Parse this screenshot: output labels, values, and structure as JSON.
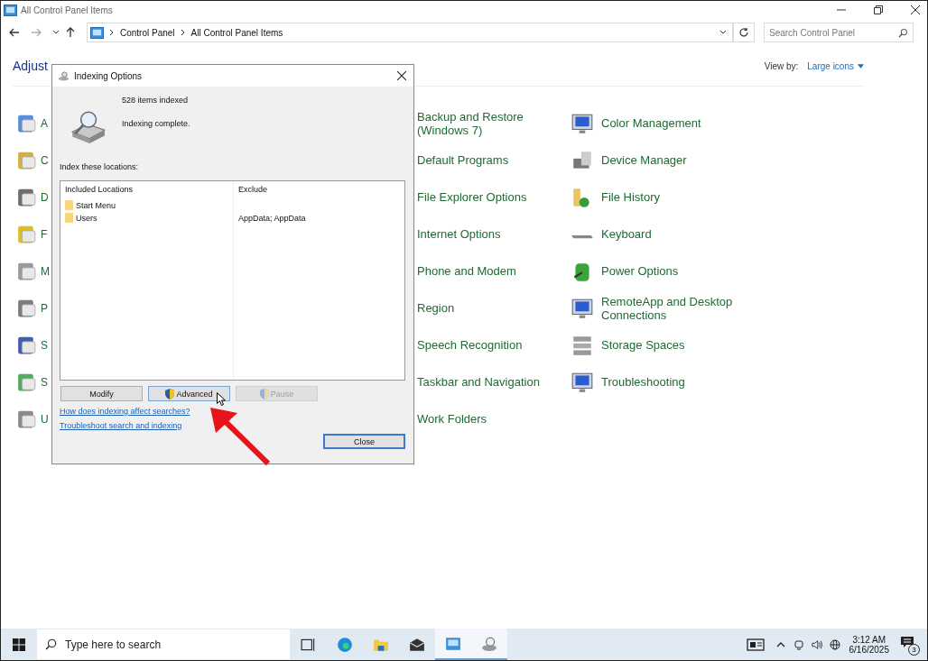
{
  "window": {
    "title": "All Control Panel Items"
  },
  "address_bar": {
    "path": [
      "Control Panel",
      "All Control Panel Items"
    ]
  },
  "search": {
    "placeholder": "Search Control Panel"
  },
  "heading": "Adjust",
  "view_by": {
    "label": "View by:",
    "value": "Large icons"
  },
  "items_column_1": [
    {
      "label": "A"
    },
    {
      "label": "C"
    },
    {
      "label": "D"
    },
    {
      "label": "F"
    },
    {
      "label": "M"
    },
    {
      "label": "P"
    },
    {
      "label": "S"
    },
    {
      "label": "S"
    },
    {
      "label": "U"
    }
  ],
  "items_column_2": [
    {
      "label": "Backup and Restore (Windows 7)"
    },
    {
      "label": "Default Programs"
    },
    {
      "label": "File Explorer Options"
    },
    {
      "label": "Internet Options"
    },
    {
      "label": "Phone and Modem"
    },
    {
      "label": "Region"
    },
    {
      "label": "Speech Recognition"
    },
    {
      "label": "Taskbar and Navigation"
    },
    {
      "label": "Work Folders"
    }
  ],
  "items_column_3": [
    {
      "label": "Color Management"
    },
    {
      "label": "Device Manager"
    },
    {
      "label": "File History"
    },
    {
      "label": "Keyboard"
    },
    {
      "label": "Power Options"
    },
    {
      "label": "RemoteApp and Desktop Connections"
    },
    {
      "label": "Storage Spaces"
    },
    {
      "label": "Troubleshooting"
    }
  ],
  "dialog": {
    "title": "Indexing Options",
    "count": "528 items indexed",
    "status": "Indexing complete.",
    "locations_label": "Index these locations:",
    "columns": [
      "Included Locations",
      "Exclude"
    ],
    "rows": [
      {
        "location": "Start Menu",
        "exclude": ""
      },
      {
        "location": "Users",
        "exclude": "AppData; AppData"
      }
    ],
    "buttons": [
      {
        "label": "Modify",
        "disabled": false,
        "shield": false
      },
      {
        "label": "Advanced",
        "disabled": false,
        "shield": true
      },
      {
        "label": "Pause",
        "disabled": true,
        "shield": true
      }
    ],
    "links": [
      "How does indexing affect searches?",
      "Troubleshoot search and indexing"
    ],
    "close_button": "Close"
  },
  "taskbar": {
    "search_placeholder": "Type here to search",
    "apps": [
      {
        "selected": false
      },
      {
        "selected": false
      },
      {
        "selected": false
      },
      {
        "selected": false
      },
      {
        "selected": true
      },
      {
        "selected": true
      }
    ],
    "time": "3:12 AM",
    "date": "6/16/2025",
    "notifications": "3"
  }
}
